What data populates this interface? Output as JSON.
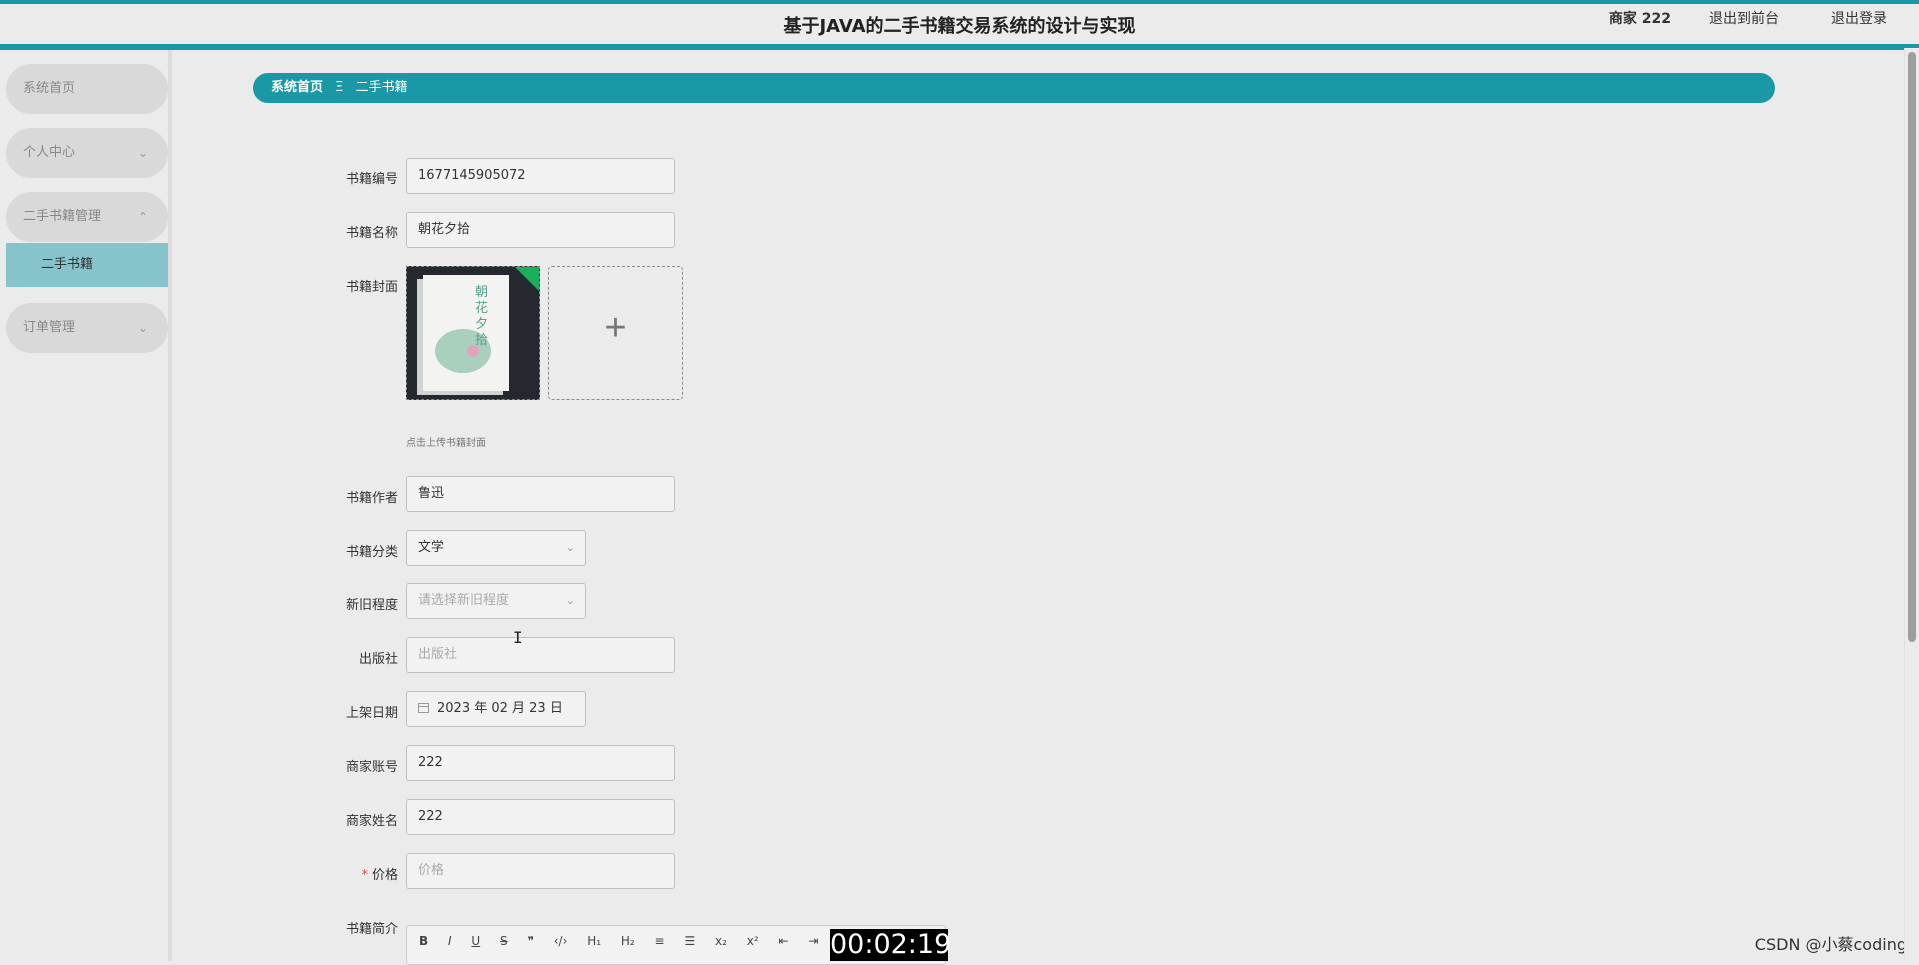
{
  "header": {
    "title": "基于JAVA的二手书籍交易系统的设计与实现",
    "user": "商家 222",
    "to_front": "退出到前台",
    "logout": "退出登录",
    "accent_color": "#1a98a5"
  },
  "sidebar": {
    "items": [
      {
        "label": "系统首页",
        "icon": ""
      },
      {
        "label": "个人中心",
        "icon": "chevron-down-icon"
      },
      {
        "label": "二手书籍管理",
        "icon": "chevron-up-icon"
      },
      {
        "label": "二手书籍",
        "icon": ""
      },
      {
        "label": "订单管理",
        "icon": "chevron-down-icon"
      }
    ]
  },
  "breadcrumb": {
    "home": "系统首页",
    "separator": "Ξ",
    "current": "二手书籍"
  },
  "form": {
    "book_no": {
      "label": "书籍编号",
      "value": "1677145905072"
    },
    "book_name": {
      "label": "书籍名称",
      "value": "朝花夕拾"
    },
    "cover": {
      "label": "书籍封面",
      "book_title_text": "朝花夕拾",
      "upload_hint": "点击上传书籍封面",
      "upload_icon": "plus-icon"
    },
    "author": {
      "label": "书籍作者",
      "value": "鲁迅"
    },
    "category": {
      "label": "书籍分类",
      "value": "文学"
    },
    "condition": {
      "label": "新旧程度",
      "placeholder": "请选择新旧程度"
    },
    "publisher": {
      "label": "出版社",
      "placeholder": "出版社"
    },
    "shelf_date": {
      "label": "上架日期",
      "value": "2023 年 02 月 23 日"
    },
    "seller_account": {
      "label": "商家账号",
      "value": "222"
    },
    "seller_name": {
      "label": "商家姓名",
      "value": "222"
    },
    "price": {
      "label": "价格",
      "required_mark": "*",
      "placeholder": "价格"
    },
    "intro": {
      "label": "书籍简介"
    }
  },
  "editor": {
    "tools": [
      "B",
      "I",
      "U",
      "S",
      "❞",
      "‹/›",
      "H₁",
      "H₂",
      "≡",
      "☰",
      "x₂",
      "x²",
      "⇤",
      "⇥"
    ]
  },
  "overlay": {
    "timer": "00:02:19",
    "watermark": "CSDN @小蔡coding"
  }
}
